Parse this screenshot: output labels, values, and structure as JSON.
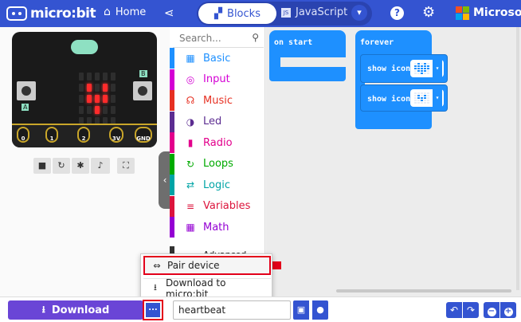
{
  "app": {
    "logo_text": "micro:bit",
    "home_label": "Home",
    "microsoft_label": "Microsoft"
  },
  "editor_tabs": {
    "blocks": "Blocks",
    "javascript": "JavaScript",
    "js_badge": "JS"
  },
  "colors": {
    "topbar": "#3454d1",
    "accent_purple": "#6a45d6",
    "block_blue": "#1e90ff",
    "highlight_red": "#e3001a"
  },
  "simulator": {
    "pins": [
      "0",
      "1",
      "2",
      "3V",
      "GND"
    ],
    "button_a": "A",
    "button_b": "B",
    "led_matrix": [
      [
        0,
        0,
        0,
        0,
        0
      ],
      [
        0,
        1,
        0,
        1,
        0
      ],
      [
        0,
        1,
        1,
        1,
        0
      ],
      [
        0,
        0,
        1,
        0,
        0
      ],
      [
        0,
        0,
        0,
        0,
        0
      ]
    ]
  },
  "toolbox": {
    "search_placeholder": "Search...",
    "categories": [
      {
        "label": "Basic",
        "color": "#1e90ff",
        "icon": "grid-icon"
      },
      {
        "label": "Input",
        "color": "#d400d4",
        "icon": "target-icon"
      },
      {
        "label": "Music",
        "color": "#e63022",
        "icon": "headphones-icon"
      },
      {
        "label": "Led",
        "color": "#5c2d91",
        "icon": "toggle-icon"
      },
      {
        "label": "Radio",
        "color": "#e3008c",
        "icon": "signal-icon"
      },
      {
        "label": "Loops",
        "color": "#00aa00",
        "icon": "refresh-icon"
      },
      {
        "label": "Logic",
        "color": "#00a4a6",
        "icon": "shuffle-icon"
      },
      {
        "label": "Variables",
        "color": "#dc143c",
        "icon": "list-icon"
      },
      {
        "label": "Math",
        "color": "#9400d3",
        "icon": "calculator-icon"
      }
    ],
    "advanced_label": "Advanced"
  },
  "workspace": {
    "on_start_label": "on start",
    "forever_label": "forever",
    "show_icon_label": "show icon"
  },
  "more_menu": {
    "pair_device": "Pair device",
    "download_to_microbit": "Download to micro:bit"
  },
  "bottom": {
    "download_label": "Download",
    "more_label": "...",
    "project_name": "heartbeat"
  }
}
